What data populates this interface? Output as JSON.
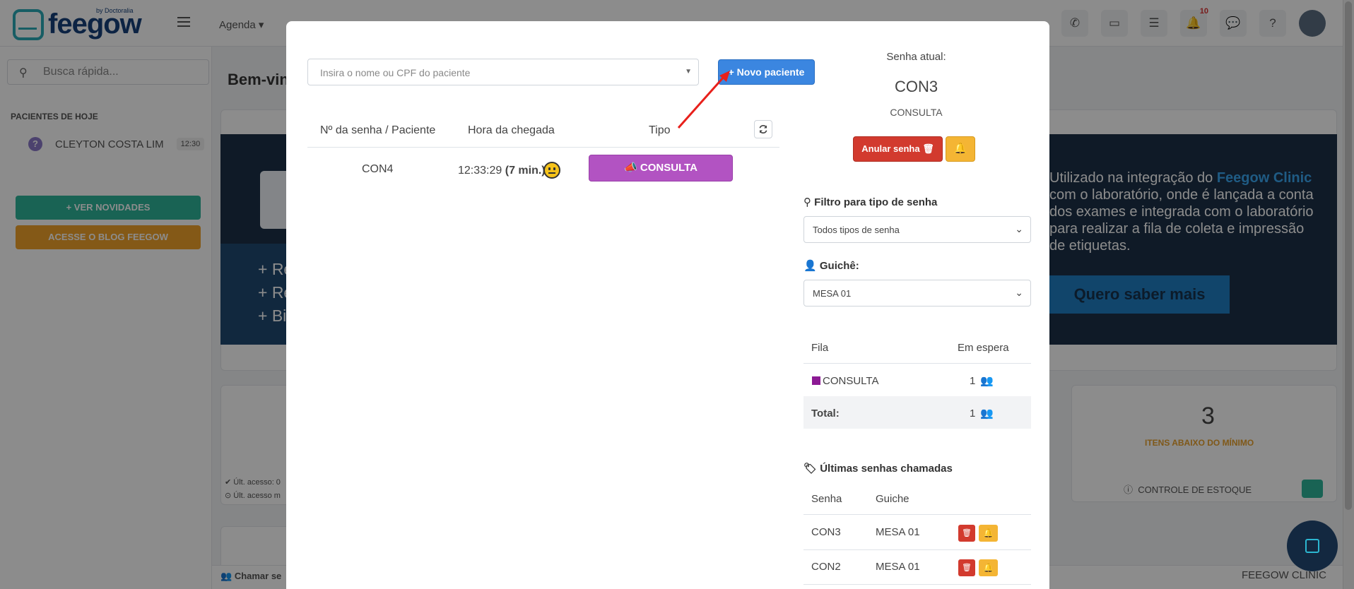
{
  "topbar": {
    "logo_text": "feegow",
    "logo_sub": "by Doctoralia",
    "nav_agenda": "Agenda ▾",
    "notifications_count": "10"
  },
  "sidebar": {
    "search_placeholder": "Busca rápida...",
    "section_title": "PACIENTES DE HOJE",
    "patient_name": "CLEYTON COSTA LIM",
    "patient_time": "12:30",
    "btn_news": "+ VER NOVIDADES",
    "btn_blog": "ACESSE O BLOG FEEGOW"
  },
  "main": {
    "title": "Bem-vin",
    "banner_list": [
      "+ Re",
      "+ Re",
      "+ Bi"
    ],
    "banner_text_pre": "Utilizado na integração do ",
    "banner_text_brand": "Feegow Clinic",
    "banner_text_post": " com o laboratório, onde é lançada a conta dos exames e integrada com o laboratório para realizar a fila de coleta e impressão de etiquetas.",
    "banner_cta": "Quero saber mais",
    "access_ok": "Últ. acesso: 0",
    "access_warn": "Últ. acesso m",
    "stock_value": "3",
    "stock_label": "ITENS ABAIXO DO MÍNIMO",
    "stock_control": "CONTROLE DE ESTOQUE",
    "footer_left": "Chamar se",
    "footer_right": "FEEGOW CLINIC"
  },
  "modal": {
    "patient_placeholder": "Insira o nome ou CPF do paciente",
    "new_patient_btn": "+ Novo paciente",
    "queue_headers": [
      "Nº da senha / Paciente",
      "Hora da chegada",
      "Tipo"
    ],
    "queue_rows": [
      {
        "code": "CON4",
        "time": "12:33:29",
        "wait": "(7 min.)",
        "type": "CONSULTA"
      }
    ],
    "current_label": "Senha atual:",
    "current_code": "CON3",
    "current_type": "CONSULTA",
    "cancel_btn": "Anular senha",
    "filter_label": "Filtro para tipo de senha",
    "filter_value": "Todos tipos de senha",
    "guiche_label": "Guichê:",
    "guiche_value": "MESA 01",
    "fila_headers": [
      "Fila",
      "Em espera"
    ],
    "fila_rows": [
      {
        "name": "CONSULTA",
        "count": "1",
        "color": "#8c1a94"
      }
    ],
    "total_label": "Total:",
    "total_count": "1",
    "last_label": "Últimas senhas chamadas",
    "last_headers": [
      "Senha",
      "Guiche"
    ],
    "last_rows": [
      {
        "code": "CON3",
        "guiche": "MESA 01"
      },
      {
        "code": "CON2",
        "guiche": "MESA 01"
      }
    ]
  }
}
